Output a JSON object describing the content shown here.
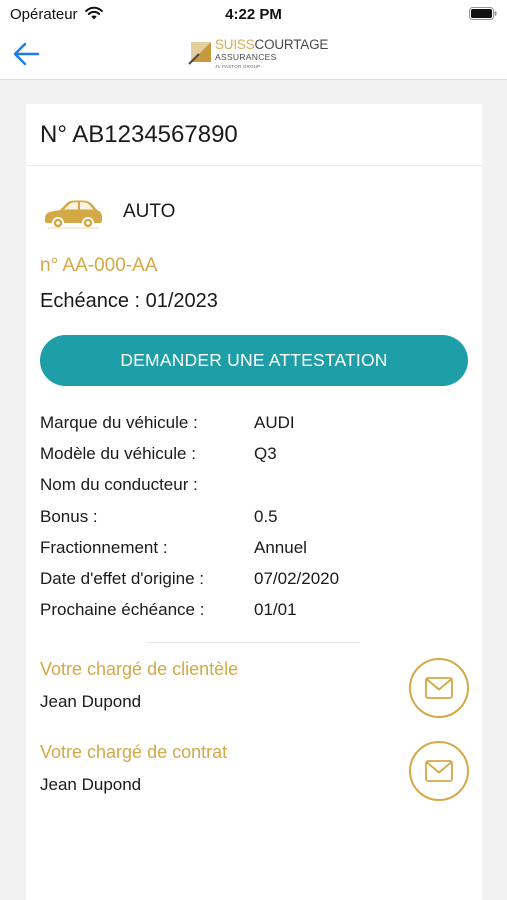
{
  "status_bar": {
    "carrier": "Opérateur",
    "time": "4:22 PM"
  },
  "nav": {
    "logo": {
      "brand_part1": "SUISS",
      "brand_part2": "COURTAGE",
      "subtitle": "ASSURANCES",
      "group": "JV PASTOR GROUP"
    }
  },
  "contract": {
    "number": "N° AB1234567890",
    "product": "AUTO",
    "plate": "n° AA-000-AA",
    "echeance_label": "Echéance : ",
    "echeance_value": "01/2023",
    "attestation_button": "DEMANDER UNE ATTESTATION",
    "details": [
      {
        "label": "Marque du véhicule :",
        "value": "AUDI"
      },
      {
        "label": "Modèle du véhicule :",
        "value": "Q3"
      },
      {
        "label": "Nom du conducteur :",
        "value": ""
      },
      {
        "label": "Bonus :",
        "value": "0.5"
      },
      {
        "label": "Fractionnement :",
        "value": "Annuel"
      },
      {
        "label": "Date d'effet d'origine :",
        "value": "07/02/2020"
      },
      {
        "label": "Prochaine échéance :",
        "value": "01/01"
      }
    ]
  },
  "contacts": [
    {
      "title": "Votre chargé de clientèle",
      "name": "Jean Dupond"
    },
    {
      "title": "Votre chargé de contrat",
      "name": "Jean Dupond"
    }
  ],
  "colors": {
    "accent_gold": "#d4a845",
    "button_teal": "#1e9ea7",
    "ios_blue": "#1a7cf0"
  },
  "icons": {
    "back": "back-arrow-icon",
    "car": "car-icon",
    "mail": "mail-icon",
    "wifi": "wifi-icon",
    "battery": "battery-icon"
  }
}
